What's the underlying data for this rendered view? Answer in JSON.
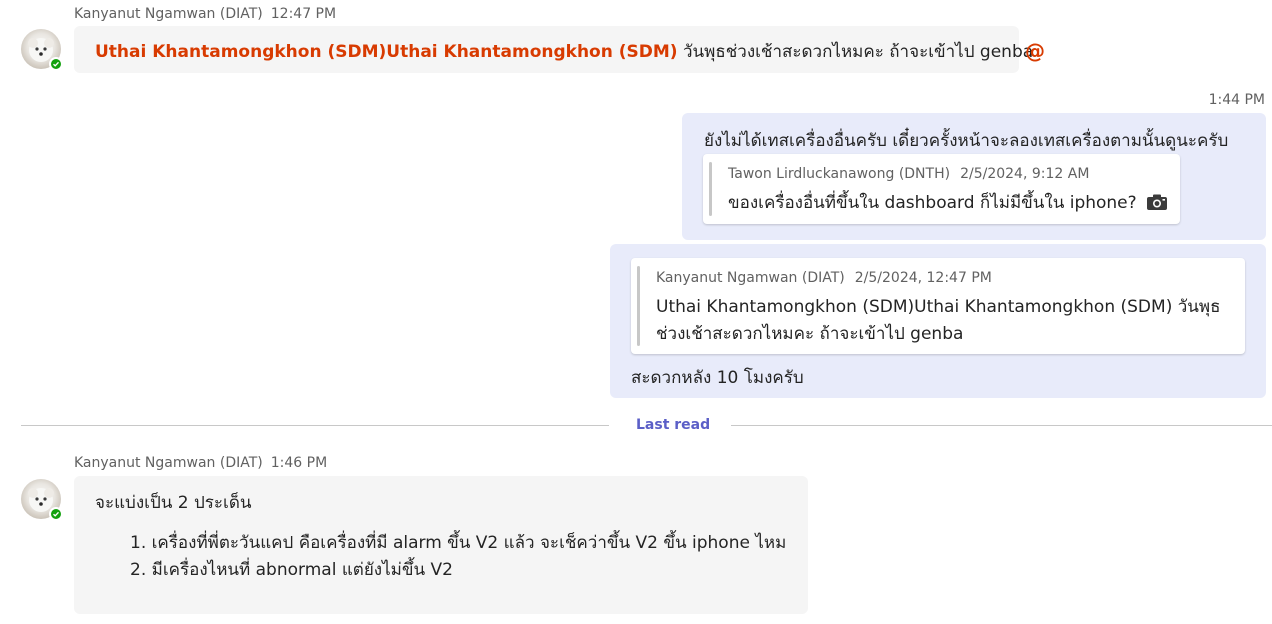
{
  "messages": {
    "m1": {
      "sender": "Kanyanut Ngamwan (DIAT)",
      "time": "12:47 PM",
      "mention": "Uthai Khantamongkhon (SDM)Uthai Khantamongkhon (SDM)",
      "text": "วันพุธช่วงเช้าสะดวกไหมคะ ถ้าจะเข้าไป genba",
      "mention_badge": "@"
    },
    "m2": {
      "time": "1:44 PM",
      "text": "ยังไม่ได้เทสเครื่องอื่นครับ เดี๋ยวครั้งหน้าจะลองเทสเครื่องตามนั้นดูนะครับ",
      "quote": {
        "author": "Tawon Lirdluckanawong (DNTH)",
        "time": "2/5/2024, 9:12 AM",
        "text": "ของเครื่องอื่นที่ขึ้นใน dashboard ก็ไม่มีขึ้นใน iphone?",
        "icon": "camera-icon"
      }
    },
    "m3": {
      "quote": {
        "author": "Kanyanut Ngamwan (DIAT)",
        "time": "2/5/2024, 12:47 PM",
        "line1": "Uthai Khantamongkhon (SDM)Uthai Khantamongkhon (SDM) วันพุธ",
        "line2": "ช่วงเช้าสะดวกไหมคะ ถ้าจะเข้าไป genba"
      },
      "text": "สะดวกหลัง 10 โมงครับ"
    },
    "divider": {
      "label": "Last read"
    },
    "m4": {
      "sender": "Kanyanut Ngamwan (DIAT)",
      "time": "1:46 PM",
      "intro": "จะแบ่งเป็น 2 ประเด็น",
      "items": [
        "1. เครื่องที่พี่ตะวันแคป คือเครื่องที่มี alarm ขึ้น V2 แล้ว จะเช็คว่าขึ้น V2 ขึ้น iphone ไหม",
        "2. มีเครื่องไหนที่ abnormal แต่ยังไม่ขึ้น V2"
      ]
    }
  },
  "colors": {
    "incoming_bubble": "#f5f5f5",
    "outgoing_bubble": "#e8ebfa",
    "mention": "#d83b01",
    "accent": "#5b5fc7",
    "presence": "#13a10e"
  }
}
